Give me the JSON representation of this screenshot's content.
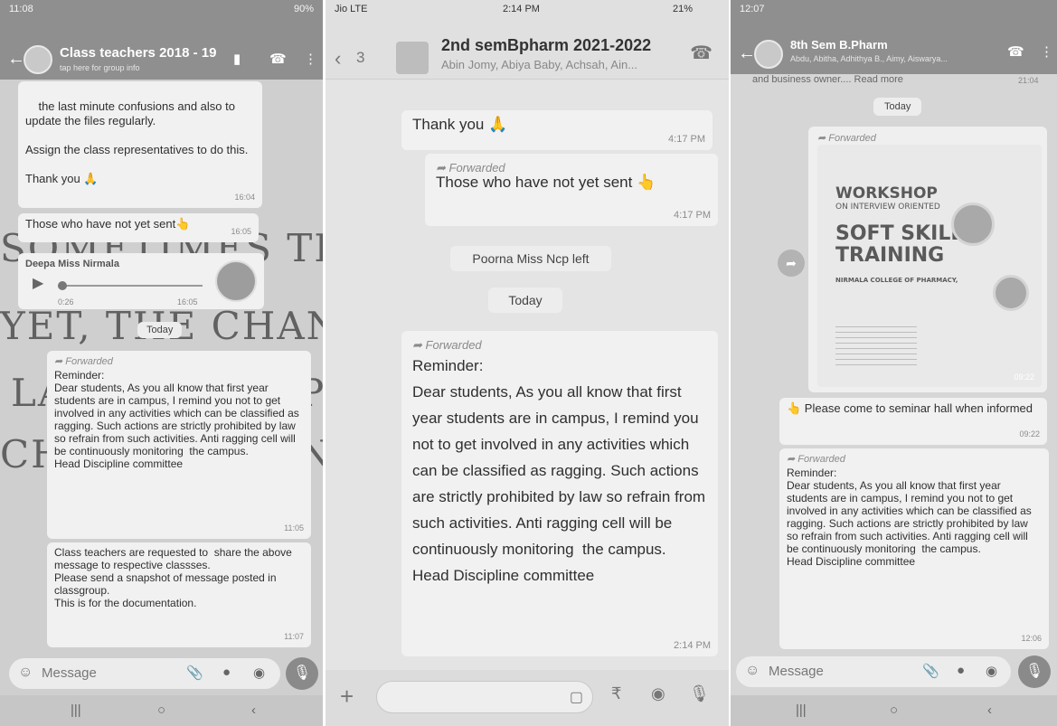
{
  "panel1": {
    "status": {
      "time": "11:08",
      "battery": "90%"
    },
    "header": {
      "title": "Class teachers 2018 - 19",
      "subtitle": "tap here for group info"
    },
    "messages": [
      {
        "text": "the last minute confusions and also to update the files regularly.\n\nAssign the class representatives to do this.\n\nThank you 🙏",
        "time": "16:04"
      },
      {
        "text": "Those who have not yet sent👆",
        "time": "16:05"
      }
    ],
    "voice": {
      "sender": "Deepa Miss Nirmala",
      "duration": "0:26",
      "time": "16:05"
    },
    "date_chip": "Today",
    "forwarded_label": "Forwarded",
    "reminder": {
      "text": "Reminder:\nDear students, As you all know that first year students are in campus, I remind you not to get involved in any activities which can be classified as ragging. Such actions are strictly prohibited by law so refrain from such activities. Anti ragging cell will be continuously monitoring  the campus.\nHead Discipline committee",
      "time": "11:05"
    },
    "followup": {
      "text": "Class teachers are requested to  share the above message to respective classses.\nPlease send a snapshot of message posted in classgroup.\nThis is for the documentation.",
      "time": "11:07"
    },
    "input_placeholder": "Message",
    "graffiti": [
      "SOMETIMES THE MORE WI",
      "YET, THE CHANCES WILL",
      "LA",
      "CHE",
      "P",
      "N"
    ]
  },
  "panel2": {
    "status": {
      "carrier": "Jio  LTE",
      "time": "2:14 PM",
      "battery": "21%"
    },
    "header": {
      "back_count": "3",
      "title": "2nd semBpharm 2021-2022",
      "subtitle": "Abin Jomy, Abiya Baby, Achsah, Ain..."
    },
    "messages": [
      {
        "text": "Thank you 🙏",
        "time": "4:17 PM"
      },
      {
        "forwarded": "Forwarded",
        "text": "Those who have not yet sent 👆",
        "time": "4:17 PM"
      }
    ],
    "system_chip": "Poorna Miss Ncp left",
    "date_chip": "Today",
    "forwarded_label": "Forwarded",
    "reminder": {
      "text": "Reminder:\nDear students, As you all know that first year students are in campus, I remind you not to get involved in any activities which can be classified as ragging. Such actions are strictly prohibited by law so refrain from such activities. Anti ragging cell will be continuously monitoring  the campus.\nHead Discipline committee",
      "time": "2:14 PM"
    }
  },
  "panel3": {
    "status": {
      "time": "12:07"
    },
    "header": {
      "title": "8th Sem B.Pharm",
      "subtitle": "Abdu, Abitha, Adhithya B., Aimy, Aiswarya..."
    },
    "top_snippet": "and business owner.... Read more",
    "top_time": "21:04",
    "date_chip": "Today",
    "forwarded_label": "Forwarded",
    "poster": {
      "line1": "WORKSHOP",
      "line2": "ON INTERVIEW ORIENTED",
      "line3": "SOFT SKILL",
      "line4": "TRAINING",
      "org": "NIRMALA COLLEGE OF PHARMACY,",
      "time": "09:22"
    },
    "caption": {
      "text": "👆 Please come to seminar hall when informed",
      "time": "09:22"
    },
    "reminder": {
      "text": "Reminder:\nDear students, As you all know that first year students are in campus, I remind you not to get involved in any activities which can be classified as ragging. Such actions are strictly prohibited by law so refrain from such activities. Anti ragging cell will be continuously monitoring  the campus.\nHead Discipline committee",
      "time": "12:06"
    },
    "input_placeholder": "Message"
  }
}
